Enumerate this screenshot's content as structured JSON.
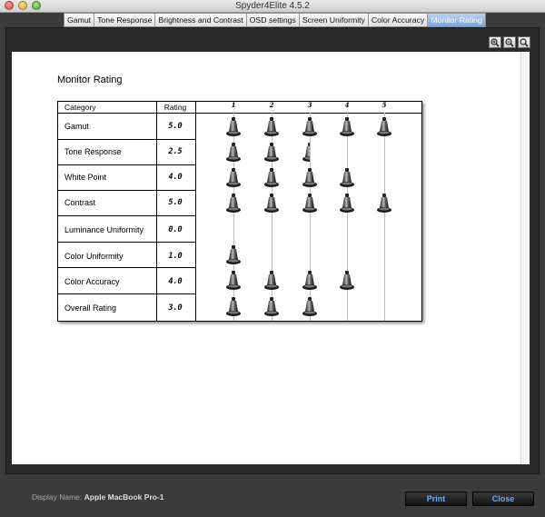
{
  "window": {
    "title": "Spyder4Elite 4.5.2"
  },
  "tabs": [
    {
      "label": "Gamut",
      "active": false
    },
    {
      "label": "Tone Response",
      "active": false
    },
    {
      "label": "Brightness and Contrast",
      "active": false
    },
    {
      "label": "OSD settings",
      "active": false
    },
    {
      "label": "Screen Uniformity",
      "active": false
    },
    {
      "label": "Color Accuracy",
      "active": false
    },
    {
      "label": "Monitor Rating",
      "active": true
    }
  ],
  "report": {
    "title": "Monitor Rating",
    "header": {
      "category": "Category",
      "rating": "Rating"
    },
    "scale": [
      "1",
      "2",
      "3",
      "4",
      "5"
    ],
    "rows": [
      {
        "category": "Gamut",
        "rating": "5.0"
      },
      {
        "category": "Tone Response",
        "rating": "2.5"
      },
      {
        "category": "White Point",
        "rating": "4.0"
      },
      {
        "category": "Contrast",
        "rating": "5.0"
      },
      {
        "category": "Luminance Uniformity",
        "rating": "0.0"
      },
      {
        "category": "Color Uniformity",
        "rating": "1.0"
      },
      {
        "category": "Color Accuracy",
        "rating": "4.0"
      },
      {
        "category": "Overall Rating",
        "rating": "3.0"
      }
    ]
  },
  "footer": {
    "display_label": "Display Name:",
    "display_value": "Apple MacBook Pro-1",
    "print_label": "Print",
    "close_label": "Close"
  },
  "icons": {
    "rating_icon": "calibrator-icon",
    "zoom_in": "zoom-in-icon",
    "zoom_out": "zoom-out-icon",
    "zoom_fit": "zoom-fit-icon"
  },
  "colors": {
    "active_tab": "#7aa6dc",
    "button_text": "#5fb1ff"
  }
}
